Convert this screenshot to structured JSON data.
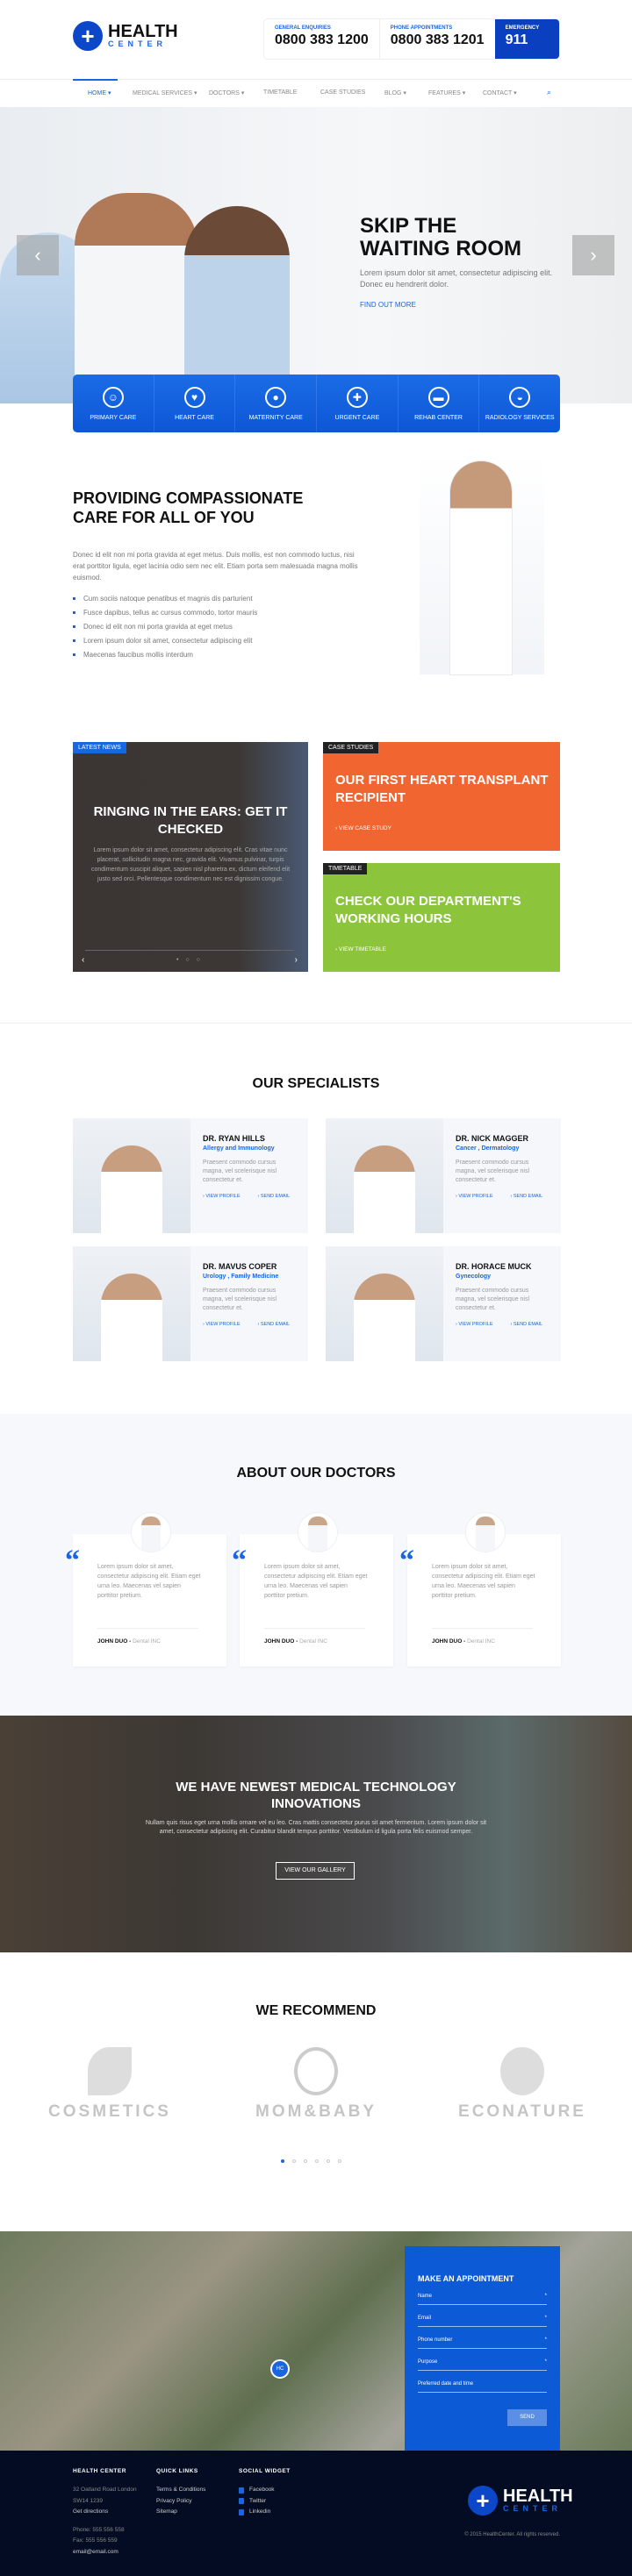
{
  "header": {
    "logo_title": "HEALTH",
    "logo_sub": "CENTER",
    "contacts": [
      {
        "label": "GENERAL ENQUIRIES",
        "value": "0800 383 1200"
      },
      {
        "label": "PHONE APPOINTMENTS",
        "value": "0800 383 1201"
      },
      {
        "label": "EMERGENCY",
        "value": "911"
      }
    ]
  },
  "nav": {
    "items": [
      "HOME",
      "MEDICAL SERVICES",
      "DOCTORS",
      "TIMETABLE",
      "CASE STUDIES",
      "BLOG",
      "FEATURES",
      "CONTACT"
    ],
    "active": "HOME"
  },
  "hero": {
    "title_l1": "SKIP THE",
    "title_l2": "WAITING ROOM",
    "text": "Lorem ipsum dolor sit amet, consectetur adipiscing elit. Donec eu hendrerit dolor.",
    "link": "FIND OUT MORE"
  },
  "services": [
    {
      "label": "PRIMARY CARE",
      "icon": "doctor-icon"
    },
    {
      "label": "HEART CARE",
      "icon": "heart-monitor-icon"
    },
    {
      "label": "MATERNITY CARE",
      "icon": "baby-icon"
    },
    {
      "label": "URGENT CARE",
      "icon": "cross-icon"
    },
    {
      "label": "REHAB CENTER",
      "icon": "bed-icon"
    },
    {
      "label": "RADIOLOGY SERVICES",
      "icon": "xray-icon"
    }
  ],
  "compassion": {
    "title_l1": "PROVIDING COMPASSIONATE",
    "title_l2": "CARE FOR ALL OF YOU",
    "text": "Donec id elit non mi porta gravida at eget metus. Duis mollis, est non commodo luctus, nisi erat porttitor ligula, eget lacinia odio sem nec elit. Etiam porta sem malesuada magna mollis euismod.",
    "list": [
      "Cum sociis natoque penatibus et magnis dis parturient",
      "Fusce dapibus, tellus ac cursus commodo, tortor mauris",
      "Donec id elit non mi porta gravida at eget metus",
      "Lorem ipsum dolor sit amet, consectetur adipiscing elit",
      "Maecenas faucibus mollis interdum"
    ]
  },
  "news": {
    "tag": "LATEST NEWS",
    "title": "RINGING IN THE EARS: GET IT CHECKED",
    "text": "Lorem ipsum dolor sit amet, consectetur adipiscing elit. Cras vitae nunc placerat, sollicitudin magna nec, gravida elit. Vivamus pulvinar, turpis condimentum suscipit aliquet, sapien nisl pharetra ex, dictum eleifend elit justo sed orci. Pellentesque condimentum nec est dignissim congue."
  },
  "case": {
    "tag": "CASE STUDIES",
    "title": "OUR FIRST HEART TRANSPLANT RECIPIENT",
    "link": "VIEW CASE STUDY"
  },
  "timetable": {
    "tag": "TIMETABLE",
    "title": "CHECK OUR DEPARTMENT'S WORKING HOURS",
    "link": "VIEW TIMETABLE"
  },
  "specialists": {
    "title": "OUR SPECIALISTS",
    "text": "Praesent commodo cursus magna, vel scelerisque nisl consectetur et.",
    "view": "VIEW PROFILE",
    "email": "SEND EMAIL",
    "doctors": [
      {
        "name": "DR. RYAN HILLS",
        "spec": "Allergy and Immunology"
      },
      {
        "name": "DR. NICK MAGGER",
        "spec": "Cancer , Dermatology"
      },
      {
        "name": "DR. MAVUS COPER",
        "spec": "Urology , Family Medicine"
      },
      {
        "name": "DR. HORACE MUCK",
        "spec": "Gynecology"
      }
    ]
  },
  "about": {
    "title": "ABOUT OUR DOCTORS",
    "quote": "Lorem ipsum dolor sit amet, consectetur adipiscing elit. Etiam eget urna leo. Maecenas vel sapien porttitor pretium.",
    "author": "JOHN DUO -",
    "company": "Dental INC"
  },
  "tech": {
    "title": "WE HAVE NEWEST MEDICAL TECHNOLOGY INNOVATIONS",
    "text": "Nullam quis risus eget urna mollis ornare vel eu leo. Cras mattis consectetur purus sit amet fermentum. Lorem ipsum dolor sit amet, consectetur adipiscing elit. Curabitur blandit tempus porttitor. Vestibulum id ligula porta felis euismod semper.",
    "button": "VIEW OUR GALLERY"
  },
  "recommend": {
    "title": "WE RECOMMEND",
    "brands": [
      "COSMETICS",
      "MOM&BABY",
      "ECONATURE"
    ],
    "pages": 6,
    "active_page": 1
  },
  "appointment": {
    "title": "MAKE AN APPOINTMENT",
    "fields": [
      "Name",
      "Email",
      "Phone number",
      "Purpose",
      "Preferred date and time"
    ],
    "send": "SEND",
    "pin": "HC"
  },
  "footer": {
    "col1_title": "HEALTH CENTER",
    "address1": "32 Oatland Road London",
    "address2": "SW14 1239",
    "directions": "Get directions",
    "phone": "Phone: 555 556 558",
    "fax": "Fax: 555 556 559",
    "email": "email@email.com",
    "col2_title": "QUICK LINKS",
    "links": [
      "Terms & Conditions",
      "Privacy Policy",
      "Sitemap"
    ],
    "col3_title": "SOCIAL WIDGET",
    "social": [
      "Facebook",
      "Twitter",
      "Linkedin"
    ],
    "copyright": "© 2015 HealthCenter. All rights reserved."
  },
  "colors": {
    "primary": "#1a66e0",
    "emergency": "#0a3fbf",
    "orange": "#f06530",
    "green": "#8cc43c",
    "footer": "#030c22"
  }
}
